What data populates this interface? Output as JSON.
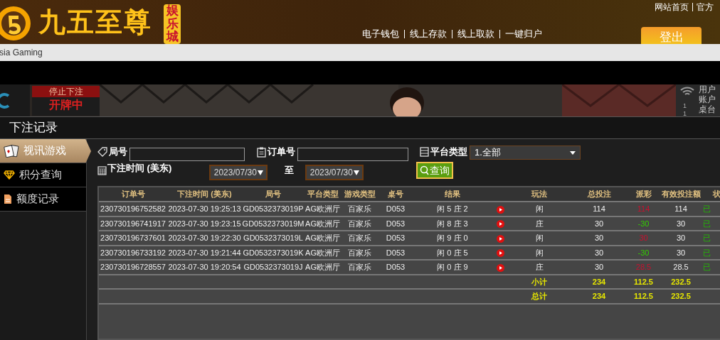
{
  "header": {
    "logo_text": "九五至尊",
    "logo_tag": "娱乐城",
    "top_links": [
      "网站首页",
      "官方"
    ],
    "nav_links": [
      "电子钱包",
      "线上存款",
      "线上取款",
      "一键归户"
    ],
    "logout": "登出"
  },
  "address_bar": {
    "text": "sia Gaming"
  },
  "video": {
    "kind": "picture",
    "status_label": "停止下注",
    "status_text": "开牌中",
    "info_labels": [
      "用户",
      "账户",
      "桌台"
    ],
    "counters": [
      "1",
      "1"
    ]
  },
  "modal": {
    "title": "下注记录",
    "sidebar": {
      "items": [
        {
          "label": "视讯游戏",
          "kind": "cards",
          "selected": true
        },
        {
          "label": "积分查询",
          "kind": "diamond",
          "selected": false
        },
        {
          "label": "额度记录",
          "kind": "document",
          "selected": false
        }
      ]
    },
    "filters": {
      "round_label": "局号",
      "order_label": "订单号",
      "platform_label": "平台类型",
      "platform_value": "1.全部",
      "time_label": "下注时间 (美东)",
      "date_from": "2023/07/30",
      "to_label": "至",
      "date_to": "2023/07/30",
      "query_button": "查询"
    },
    "table": {
      "columns": [
        "订单号",
        "下注时间 (美东)",
        "局号",
        "平台类型",
        "游戏类型",
        "桌号",
        "结果",
        "",
        "玩法",
        "总投注",
        "派彩",
        "有效投注额",
        "状"
      ],
      "rows": [
        {
          "order": "230730196752582",
          "time": "2023-07-30 19:25:13",
          "round": "GD0532373019P",
          "platform": "AG欧洲厅",
          "game": "百家乐",
          "table": "D053",
          "result": "闲 5 庄 2",
          "play": "闲",
          "bet": "114",
          "payout": "114",
          "kind": "win",
          "valid": "114",
          "status": "已"
        },
        {
          "order": "230730196741917",
          "time": "2023-07-30 19:23:15",
          "round": "GD0532373019M",
          "platform": "AG欧洲厅",
          "game": "百家乐",
          "table": "D053",
          "result": "闲 8 庄 3",
          "play": "庄",
          "bet": "30",
          "payout": "-30",
          "kind": "loss",
          "valid": "30",
          "status": "已"
        },
        {
          "order": "230730196737601",
          "time": "2023-07-30 19:22:30",
          "round": "GD0532373019L",
          "platform": "AG欧洲厅",
          "game": "百家乐",
          "table": "D053",
          "result": "闲 9 庄 0",
          "play": "闲",
          "bet": "30",
          "payout": "30",
          "kind": "win",
          "valid": "30",
          "status": "已"
        },
        {
          "order": "230730196733192",
          "time": "2023-07-30 19:21:44",
          "round": "GD0532373019K",
          "platform": "AG欧洲厅",
          "game": "百家乐",
          "table": "D053",
          "result": "闲 0 庄 5",
          "play": "闲",
          "bet": "30",
          "payout": "-30",
          "kind": "loss",
          "valid": "30",
          "status": "已"
        },
        {
          "order": "230730196728557",
          "time": "2023-07-30 19:20:54",
          "round": "GD0532373019J",
          "platform": "AG欧洲厅",
          "game": "百家乐",
          "table": "D053",
          "result": "闲 0 庄 9",
          "play": "庄",
          "bet": "30",
          "payout": "28.5",
          "kind": "win",
          "valid": "28.5",
          "status": "已"
        }
      ],
      "summary": [
        {
          "label": "小计",
          "bet": "234",
          "payout": "112.5",
          "valid": "232.5"
        },
        {
          "label": "总计",
          "bet": "234",
          "payout": "112.5",
          "valid": "232.5"
        }
      ]
    }
  }
}
